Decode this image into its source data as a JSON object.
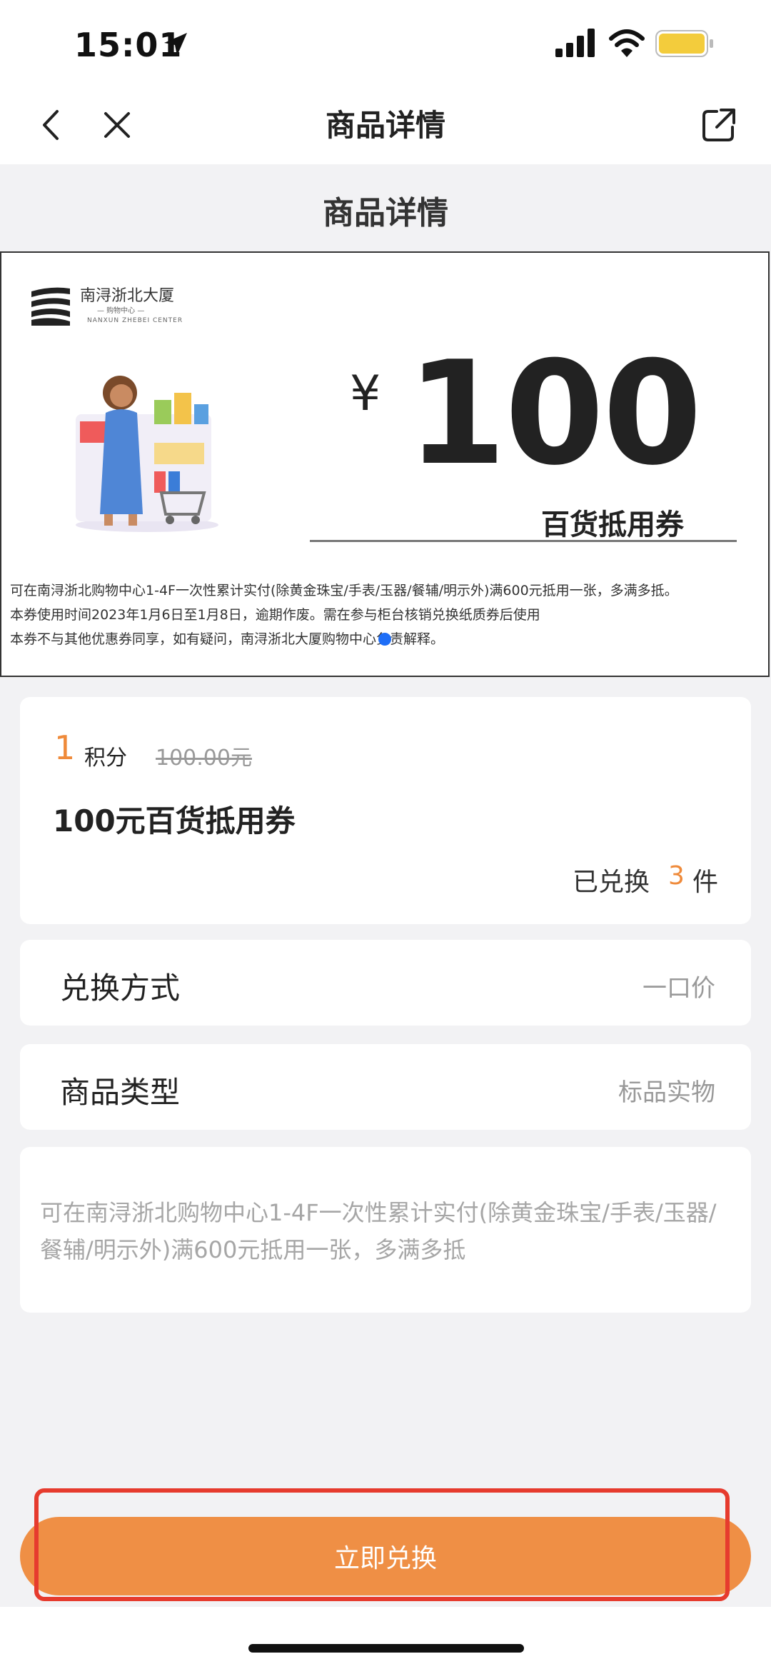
{
  "status": {
    "time": "15:01"
  },
  "nav": {
    "title": "商品详情"
  },
  "page": {
    "section_title": "商品详情"
  },
  "coupon": {
    "brand_name": "南浔浙北大厦",
    "brand_sub1": "— 购物中心 —",
    "brand_sub2": "NANXUN ZHEBEI CENTER",
    "currency": "¥",
    "amount": "100",
    "type": "百货抵用券",
    "terms": [
      "可在南浔浙北购物中心1-4F一次性累计实付(除黄金珠宝/手表/玉器/餐辅/明示外)满600元抵用一张，多满多抵。",
      "本券使用时间2023年1月6日至1月8日，逾期作废。需在参与柜台核销兑换纸质券后使用",
      "本券不与其他优惠券同享，如有疑问，南浔浙北大厦购物中心负责解释。"
    ]
  },
  "product": {
    "points": "1",
    "points_label": "积分",
    "original_price": "100.00元",
    "name": "100元百货抵用券",
    "redeemed_label": "已兑换",
    "redeemed_count": "3",
    "redeemed_unit": "件"
  },
  "details": {
    "method_label": "兑换方式",
    "method_value": "一口价",
    "type_label": "商品类型",
    "type_value": "标品实物"
  },
  "description": "可在南浔浙北购物中心1-4F一次性累计实付(除黄金珠宝/手表/玉器/餐辅/明示外)满600元抵用一张，多满多抵",
  "button": {
    "label": "立即兑换"
  },
  "colors": {
    "accent": "#ef8a3a",
    "button": "#ef8f45",
    "highlight": "#e63b2e"
  }
}
